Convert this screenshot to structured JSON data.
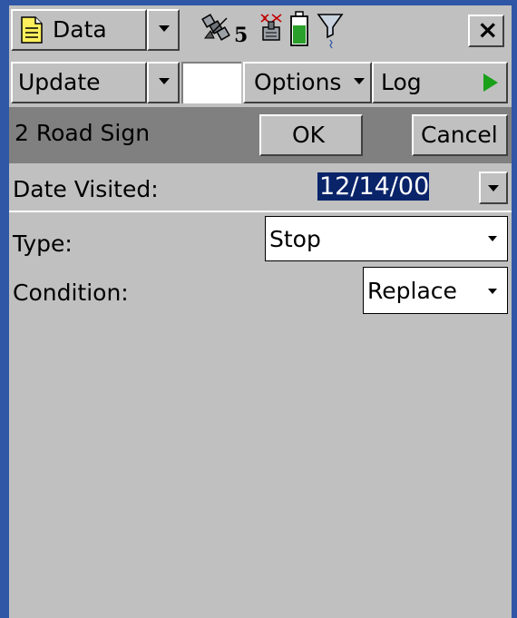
{
  "toolbar": {
    "data_menu_label": "Data",
    "satellite_count": "5",
    "close_label": "×"
  },
  "second_bar": {
    "update_label": "Update",
    "options_label": "Options",
    "log_label": "Log"
  },
  "form_header": {
    "title": "2 Road Sign",
    "ok_label": "OK",
    "cancel_label": "Cancel"
  },
  "fields": {
    "date_visited": {
      "label": "Date Visited:",
      "value": "12/14/00"
    },
    "type": {
      "label": "Type:",
      "value": "Stop"
    },
    "condition": {
      "label": "Condition:",
      "value": "Replace"
    }
  },
  "colors": {
    "frame_border": "#2f57a6",
    "panel": "#c0c0c0",
    "header_dark": "#808080",
    "selection": "#0a246a",
    "log_play": "#1aa01a",
    "battery": "#2aa02a"
  }
}
